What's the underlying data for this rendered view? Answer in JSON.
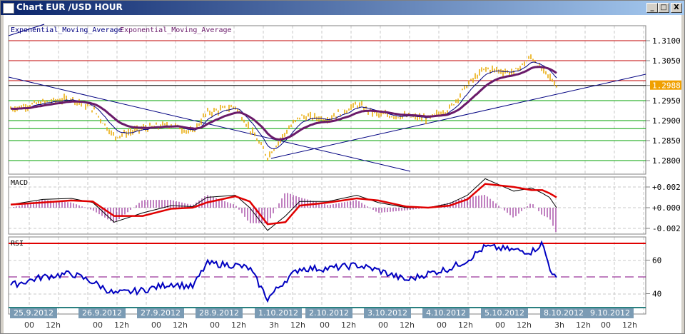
{
  "window": {
    "title": "Chart EUR /USD  HOUR",
    "buttons": {
      "minimize": "_",
      "maximize": "□",
      "close": "X"
    }
  },
  "legend": {
    "ema1": "Exponential_Moving_Average",
    "ema2": "Exponential_Moving_Average"
  },
  "panels": {
    "macd_label": "MACD",
    "rsi_label": "RSI"
  },
  "colors": {
    "candle": "#e8a800",
    "ema_fast": "#000080",
    "ema_slow": "#6a1a6a",
    "trend": "#000080",
    "resistance": "#c00000",
    "support": "#00a000",
    "macd_signal": "#e00000",
    "histogram": "#800080",
    "rsi": "#0000c0",
    "last_price_bg": "#f0a000"
  },
  "chart_data": [
    {
      "type": "line",
      "name": "price",
      "title": "Chart EUR /USD  HOUR",
      "x": [
        0,
        45,
        85,
        115,
        145,
        185,
        225,
        255,
        275,
        315,
        335,
        360,
        385,
        405,
        445,
        485,
        515,
        555,
        585,
        615,
        640,
        665,
        705,
        730,
        745,
        755,
        765
      ],
      "values": [
        1.293,
        1.2945,
        1.2955,
        1.293,
        1.286,
        1.288,
        1.289,
        1.287,
        1.292,
        1.2935,
        1.288,
        1.281,
        1.287,
        1.291,
        1.2905,
        1.294,
        1.2915,
        1.291,
        1.2905,
        1.293,
        1.299,
        1.303,
        1.302,
        1.306,
        1.3025,
        1.301,
        1.2988
      ],
      "yticks": [
        "1.3100",
        "1.3050",
        "1.2988",
        "1.2950",
        "1.2900",
        "1.2850",
        "1.2800"
      ],
      "ylim": [
        1.2775,
        1.314
      ],
      "last_price": "1.2988",
      "horizontal_levels": {
        "resistance": [
          1.31,
          1.305,
          1.3
        ],
        "support": [
          1.295,
          1.29,
          1.288,
          1.285,
          1.28
        ],
        "last": 1.2988
      }
    },
    {
      "type": "line",
      "name": "MACD",
      "x": [
        0,
        45,
        85,
        115,
        145,
        185,
        225,
        255,
        275,
        315,
        335,
        360,
        385,
        405,
        445,
        485,
        515,
        555,
        585,
        615,
        640,
        665,
        705,
        730,
        745,
        755,
        765
      ],
      "macd": [
        0.0003,
        0.0008,
        0.0009,
        0.0005,
        -0.0014,
        -0.0005,
        0.0002,
        0.0001,
        0.001,
        0.0012,
        0.0,
        -0.0022,
        -0.0008,
        0.0006,
        0.0006,
        0.0012,
        0.0005,
        0.0,
        0.0,
        0.0004,
        0.0012,
        0.0028,
        0.0016,
        0.0019,
        0.0014,
        0.001,
        0.0
      ],
      "signal": [
        0.0003,
        0.0005,
        0.0007,
        0.0006,
        -0.0008,
        -0.0008,
        -0.0001,
        0.0,
        0.0005,
        0.0011,
        0.0006,
        -0.0016,
        -0.0014,
        0.0002,
        0.0005,
        0.0009,
        0.0007,
        0.0001,
        0.0,
        0.0002,
        0.0008,
        0.0023,
        0.002,
        0.0017,
        0.0017,
        0.0014,
        0.001
      ],
      "yticks": [
        "+0.002",
        "+0.000",
        "-0.002"
      ],
      "ylim": [
        -0.0027,
        0.0027
      ]
    },
    {
      "type": "line",
      "name": "RSI",
      "x": [
        0,
        45,
        85,
        115,
        145,
        185,
        225,
        255,
        275,
        315,
        335,
        360,
        385,
        405,
        445,
        485,
        515,
        555,
        585,
        615,
        640,
        665,
        705,
        730,
        745,
        755,
        765
      ],
      "values": [
        45,
        50,
        52,
        47,
        40,
        42,
        46,
        44,
        58,
        57,
        55,
        37,
        48,
        55,
        55,
        57,
        54,
        48,
        52,
        55,
        60,
        68,
        66,
        65,
        70,
        56,
        48
      ],
      "yticks": [
        "60",
        "40"
      ],
      "ylim": [
        35,
        72
      ],
      "upper": 70,
      "middle": 50
    }
  ],
  "axis": {
    "dates": [
      "25.9.2012",
      "26.9.2012",
      "27.9.2012",
      "28.9.2012",
      "1.10.2012",
      "2.10.2012",
      "3.10.2012",
      "4.10.2012",
      "5.10.2012",
      "8.10.2012",
      "9.10.2012"
    ],
    "hours": [
      [
        "00",
        "12h"
      ],
      [
        "00",
        "12h"
      ],
      [
        "00",
        "12h"
      ],
      [
        "00",
        "12h"
      ],
      [
        "3h",
        "12h"
      ],
      [
        "00",
        "12h"
      ],
      [
        "00",
        "12h"
      ],
      [
        "00",
        "12h"
      ],
      [
        "00",
        "12h"
      ],
      [
        "3h",
        "12h"
      ],
      [
        "00",
        "12h"
      ]
    ]
  }
}
